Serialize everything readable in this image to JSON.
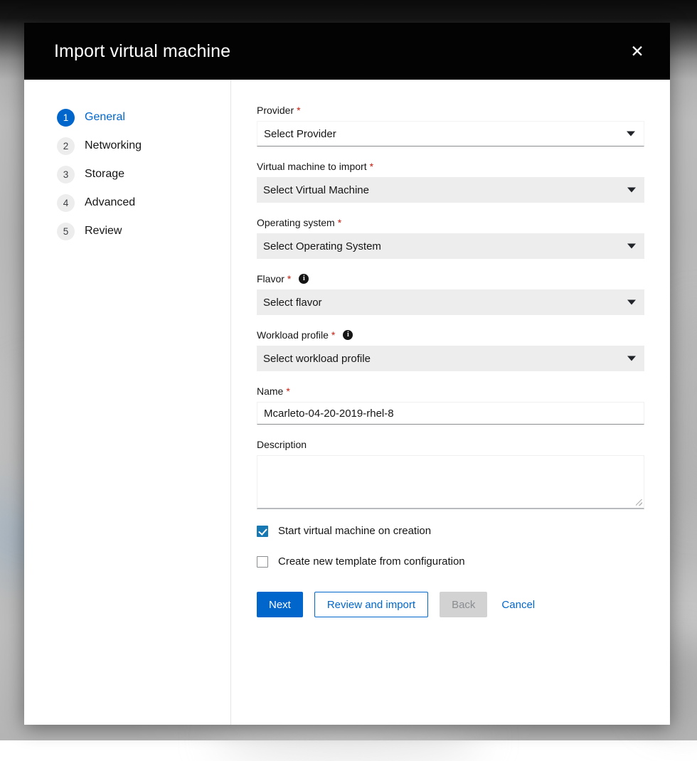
{
  "modal": {
    "title": "Import virtual machine",
    "close_icon_label": "✕"
  },
  "wizard": {
    "steps": [
      {
        "number": "1",
        "label": "General",
        "active": true
      },
      {
        "number": "2",
        "label": "Networking",
        "active": false
      },
      {
        "number": "3",
        "label": "Storage",
        "active": false
      },
      {
        "number": "4",
        "label": "Advanced",
        "active": false
      },
      {
        "number": "5",
        "label": "Review",
        "active": false
      }
    ]
  },
  "form": {
    "provider": {
      "label": "Provider",
      "required_marker": "*",
      "value": "Select Provider"
    },
    "virtual_machine": {
      "label": "Virtual machine to import",
      "required_marker": "*",
      "value": "Select Virtual Machine"
    },
    "operating_system": {
      "label": "Operating system",
      "required_marker": "*",
      "value": "Select Operating System"
    },
    "flavor": {
      "label": "Flavor",
      "required_marker": "*",
      "info_glyph": "i",
      "value": "Select flavor"
    },
    "workload_profile": {
      "label": "Workload profile",
      "required_marker": "*",
      "info_glyph": "i",
      "value": "Select workload profile"
    },
    "name": {
      "label": "Name",
      "required_marker": "*",
      "value": "Mcarleto-04-20-2019-rhel-8"
    },
    "description": {
      "label": "Description",
      "value": "",
      "placeholder": ""
    },
    "start_vm_checkbox": {
      "label": "Start virtual machine on creation",
      "checked": true
    },
    "create_template_checkbox": {
      "label": "Create new template from configuration",
      "checked": false
    }
  },
  "buttons": {
    "next": "Next",
    "review_and_import": "Review and import",
    "back": "Back",
    "cancel": "Cancel"
  },
  "colors": {
    "accent_blue": "#0066cc",
    "checkbox_blue": "#1679b4",
    "required_red": "#c9190b",
    "header_black": "#030303",
    "disabled_field_grey": "#ededed",
    "disabled_button_grey": "#d2d2d2"
  }
}
